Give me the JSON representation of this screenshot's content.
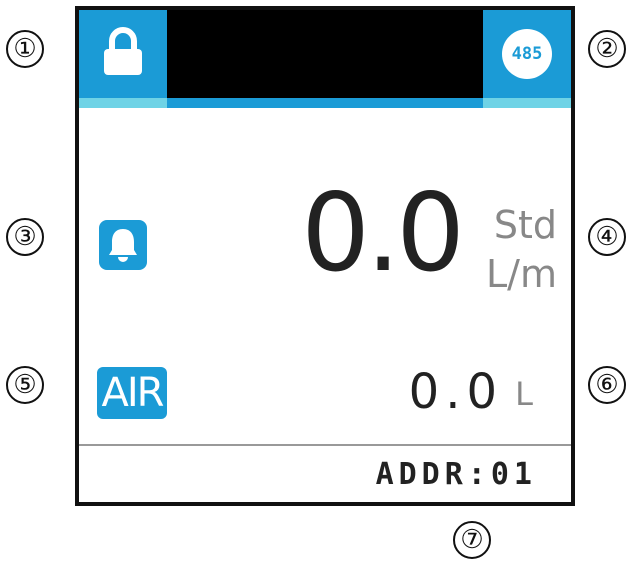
{
  "callouts": [
    "①",
    "②",
    "③",
    "④",
    "⑤",
    "⑥",
    "⑦"
  ],
  "header": {
    "lock_icon": "lock-icon",
    "rs485_label": "485"
  },
  "flow": {
    "value": "0.0",
    "unit_top": "Std",
    "unit_bottom": "L/m",
    "alarm_icon": "bell-icon"
  },
  "totalizer": {
    "gas": "AIR",
    "value": "0.0",
    "unit": "L"
  },
  "footer": {
    "address": "ADDR:01"
  },
  "colors": {
    "accent": "#1b9bd6",
    "accent_light": "#6fd3e6",
    "bar": "#000000",
    "text": "#222222",
    "unit_text": "#888888"
  }
}
